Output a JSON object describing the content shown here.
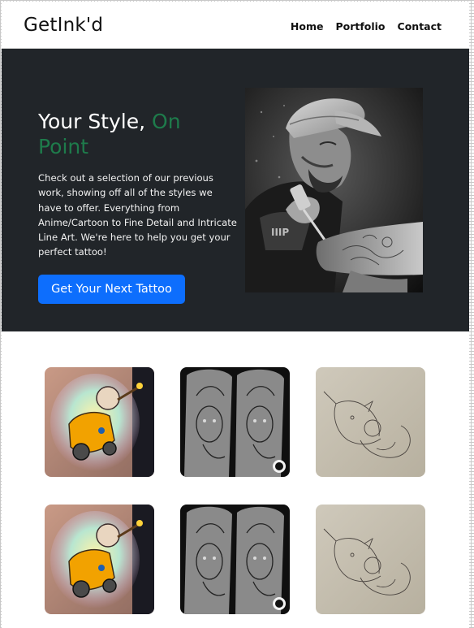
{
  "nav": {
    "brand": "GetInk'd",
    "links": [
      "Home",
      "Portfolio",
      "Contact"
    ]
  },
  "hero": {
    "title_part1": "Your Style, ",
    "title_accent": "On Point",
    "description": "Check out a selection of our previous work, showing off all of the styles we have to offer. Everything from Anime/Cartoon to Fine Detail and Intricate Line Art. We're here to help you get your perfect tattoo!",
    "cta_label": "Get Your Next Tattoo"
  },
  "gallery": {
    "items": [
      {
        "subject": "cartoon-character-color-tattoo"
      },
      {
        "subject": "realism-portrait-sleeve-tattoo"
      },
      {
        "subject": "line-art-rhino-stencil-tattoo"
      },
      {
        "subject": "cartoon-character-color-tattoo"
      },
      {
        "subject": "realism-portrait-sleeve-tattoo"
      },
      {
        "subject": "line-art-rhino-stencil-tattoo"
      }
    ]
  },
  "colors": {
    "hero_bg": "#212529",
    "accent_green": "#1e7b4b",
    "button_blue": "#0d6efd"
  }
}
